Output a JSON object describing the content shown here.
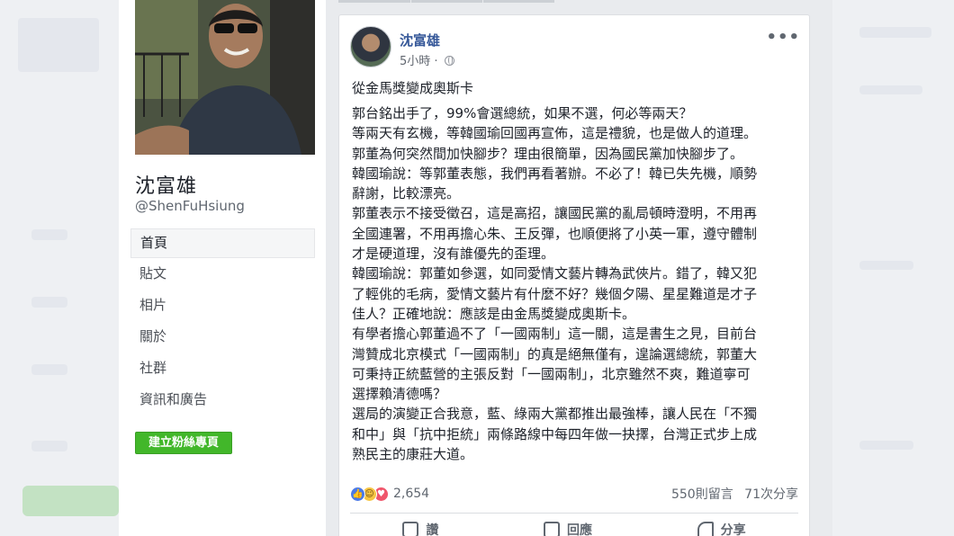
{
  "profile": {
    "name": "沈富雄",
    "handle": "@ShenFuHsiung"
  },
  "nav": {
    "items": [
      "首頁",
      "貼文",
      "相片",
      "關於",
      "社群",
      "資訊和廣告"
    ],
    "create_button": "建立粉絲專頁"
  },
  "post": {
    "author": "沈富雄",
    "time": "5小時 ·",
    "more": "•••",
    "title": "從金馬獎變成奧斯卡",
    "lines": [
      "郭台銘出手了，99%會選總統，如果不選，何必等兩天？",
      "等兩天有玄機，等韓國瑜回國再宣佈，這是禮貌，也是做人的道理。",
      "郭董為何突然間加快腳步？理由很簡單，因為國民黨加快腳步了。",
      "韓國瑜說：等郭董表態，我們再看著辦。不必了！韓已失先機，順勢",
      "辭謝，比較漂亮。",
      "郭董表示不接受徵召，這是高招，讓國民黨的亂局頓時澄明，不用再",
      "全國連署，不用再擔心朱、王反彈，也順便將了小英一軍，遵守體制",
      "才是硬道理，沒有誰優先的歪理。",
      "韓國瑜說：郭董如參選，如同愛情文藝片轉為武俠片。錯了，韓又犯",
      "了輕佻的毛病，愛情文藝片有什麼不好？幾個夕陽、星星難道是才子",
      "佳人？正確地說：應該是由金馬獎變成奧斯卡。",
      "有學者擔心郭董過不了「一國兩制」這一關，這是書生之見，目前台",
      "灣贊成北京模式「一國兩制」的真是絕無僅有，遑論選總統，郭董大",
      "可秉持正統藍營的主張反對「一國兩制」，北京雖然不爽，難道寧可",
      "選擇賴清德嗎？",
      "選局的演變正合我意，藍、綠兩大黨都推出最強棒，讓人民在「不獨",
      "和中」與「抗中拒統」兩條路線中每四年做一抉擇，台灣正式步上成",
      "熟民主的康莊大道。"
    ],
    "reaction_count": "2,654",
    "comments": "550則留言",
    "shares": "71次分享",
    "actions": [
      "讚",
      "回應",
      "分享"
    ]
  },
  "colors": {
    "link": "#365899",
    "create_button": "#42b72a",
    "like": "#4a7ae8",
    "love": "#f0566b",
    "haha": "#f6c542"
  },
  "icons": [
    "globe-icon",
    "more-icon",
    "like-reaction-icon",
    "haha-reaction-icon",
    "love-reaction-icon",
    "like-icon",
    "comment-icon",
    "share-icon"
  ]
}
